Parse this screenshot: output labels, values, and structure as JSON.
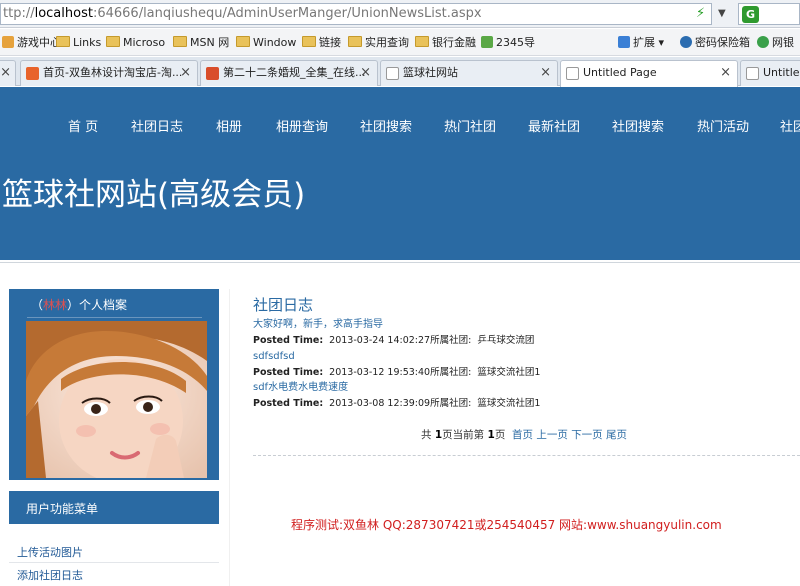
{
  "browser": {
    "url_prefix": "ttp://",
    "url_host": "localhost",
    "url_rest": ":64666/lanqiushequ/AdminUserManger/UnionNewsList.aspx",
    "bookmarks": [
      "游戏中心",
      "Links",
      "Microso",
      "MSN 网",
      "Window",
      "链接",
      "实用查询",
      "银行金融",
      "2345导"
    ],
    "right_tools": [
      "扩展",
      "密码保险箱",
      "网银"
    ],
    "tabs": [
      {
        "label": "首页-双鱼林设计淘宝店-淘...",
        "close": "×"
      },
      {
        "label": "第二十二条婚规_全集_在线...",
        "close": "×"
      },
      {
        "label": "篮球社网站",
        "close": "×"
      },
      {
        "label": "Untitled Page",
        "close": "×"
      },
      {
        "label": "Untitled",
        "close": ""
      }
    ]
  },
  "header": {
    "nav": [
      "首 页",
      "社团日志",
      "相册",
      "相册查询",
      "社团搜索",
      "热门社团",
      "最新社团",
      "社团搜索",
      "热门活动",
      "社团"
    ],
    "title": "篮球社网站(高级会员)"
  },
  "sidebar": {
    "profile": {
      "open": "（",
      "name": "林林",
      "close": "）",
      "suffix": "个人档案"
    },
    "menu_title": "用户功能菜单",
    "menu_items": [
      "上传活动图片",
      "添加社团日志"
    ]
  },
  "main": {
    "section_title": "社团日志",
    "news": [
      {
        "title": "大家好啊，新手，求高手指导",
        "label": "Posted Time:",
        "time": "2013-03-24 14:02:27",
        "club_label": "所属社团:",
        "club": "乒乓球交流团"
      },
      {
        "title": "sdfsdfsd",
        "label": "Posted Time:",
        "time": "2013-03-12 19:53:40",
        "club_label": "所属社团:",
        "club": "篮球交流社团1"
      },
      {
        "title": "sdf水电费水电费速度",
        "label": "Posted Time:",
        "time": "2013-03-08 12:39:09",
        "club_label": "所属社团:",
        "club": "篮球交流社团1"
      }
    ],
    "pager": {
      "total_prefix": "共",
      "total": "1",
      "mid": "页当前第",
      "current": "1",
      "page_suffix": "页",
      "first": "首页",
      "prev": "上一页",
      "next": "下一页",
      "last": "尾页"
    },
    "footer": "程序测试:双鱼林 QQ:287307421或254540457 网站:www.shuangyulin.com"
  },
  "colors": {
    "header_blue": "#2a6aa3",
    "link_blue": "#2a6aa3",
    "footer_red": "#d11f1f",
    "name_red": "#e05050"
  }
}
